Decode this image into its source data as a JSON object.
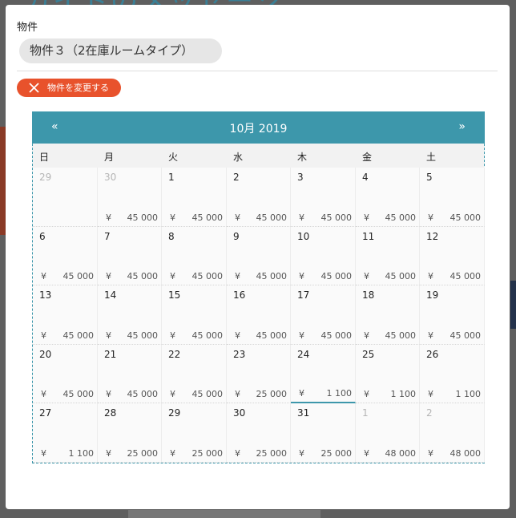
{
  "background": {
    "header_text": "ガイドのメッセージ"
  },
  "modal": {
    "field_label": "物件",
    "property_name": "物件３（2在庫ルームタイプ）",
    "change_button_label": "物件を変更する"
  },
  "calendar": {
    "title": "10月 2019",
    "prev": "«",
    "next": "»",
    "weekdays": [
      "日",
      "月",
      "火",
      "水",
      "木",
      "金",
      "土"
    ],
    "currency": "¥",
    "selected_day": "24",
    "weeks": [
      [
        {
          "day": "29",
          "muted": true,
          "price": ""
        },
        {
          "day": "30",
          "muted": true,
          "price": "45 000"
        },
        {
          "day": "1",
          "muted": false,
          "price": "45 000"
        },
        {
          "day": "2",
          "muted": false,
          "price": "45 000"
        },
        {
          "day": "3",
          "muted": false,
          "price": "45 000"
        },
        {
          "day": "4",
          "muted": false,
          "price": "45 000"
        },
        {
          "day": "5",
          "muted": false,
          "price": "45 000"
        }
      ],
      [
        {
          "day": "6",
          "muted": false,
          "price": "45 000"
        },
        {
          "day": "7",
          "muted": false,
          "price": "45 000"
        },
        {
          "day": "8",
          "muted": false,
          "price": "45 000"
        },
        {
          "day": "9",
          "muted": false,
          "price": "45 000"
        },
        {
          "day": "10",
          "muted": false,
          "price": "45 000"
        },
        {
          "day": "11",
          "muted": false,
          "price": "45 000"
        },
        {
          "day": "12",
          "muted": false,
          "price": "45 000"
        }
      ],
      [
        {
          "day": "13",
          "muted": false,
          "price": "45 000"
        },
        {
          "day": "14",
          "muted": false,
          "price": "45 000"
        },
        {
          "day": "15",
          "muted": false,
          "price": "45 000"
        },
        {
          "day": "16",
          "muted": false,
          "price": "45 000"
        },
        {
          "day": "17",
          "muted": false,
          "price": "45 000"
        },
        {
          "day": "18",
          "muted": false,
          "price": "45 000"
        },
        {
          "day": "19",
          "muted": false,
          "price": "45 000"
        }
      ],
      [
        {
          "day": "20",
          "muted": false,
          "price": "45 000"
        },
        {
          "day": "21",
          "muted": false,
          "price": "45 000"
        },
        {
          "day": "22",
          "muted": false,
          "price": "45 000"
        },
        {
          "day": "23",
          "muted": false,
          "price": "25 000"
        },
        {
          "day": "24",
          "muted": false,
          "price": "1 100"
        },
        {
          "day": "25",
          "muted": false,
          "price": "1 100"
        },
        {
          "day": "26",
          "muted": false,
          "price": "1 100"
        }
      ],
      [
        {
          "day": "27",
          "muted": false,
          "price": "1 100"
        },
        {
          "day": "28",
          "muted": false,
          "price": "25 000"
        },
        {
          "day": "29",
          "muted": false,
          "price": "25 000"
        },
        {
          "day": "30",
          "muted": false,
          "price": "25 000"
        },
        {
          "day": "31",
          "muted": false,
          "price": "25 000"
        },
        {
          "day": "1",
          "muted": true,
          "price": "48 000"
        },
        {
          "day": "2",
          "muted": true,
          "price": "48 000"
        }
      ]
    ]
  },
  "colors": {
    "accent": "#3d97ab",
    "button": "#e8522c"
  }
}
